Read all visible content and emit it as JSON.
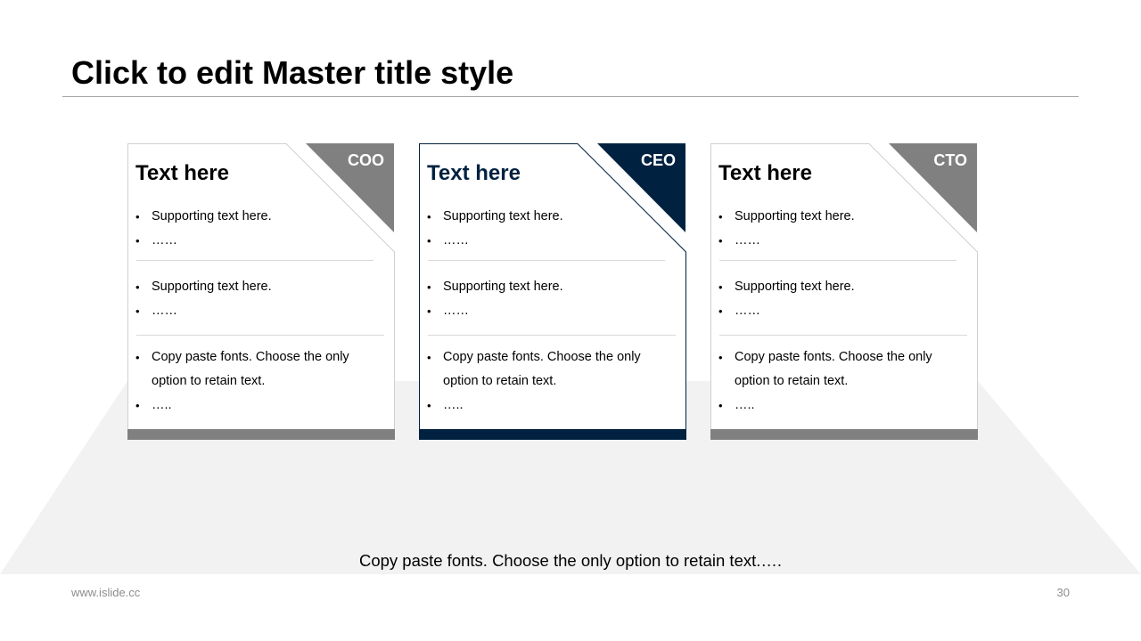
{
  "slide": {
    "title": "Click to edit Master title style",
    "caption": "Copy paste fonts. Choose the only option to retain text.….",
    "footer_url": "www.islide.cc",
    "page_number": "30"
  },
  "colors": {
    "accent_navy": "#002140",
    "gray": "#808080",
    "floor": "#f2f2f2",
    "separator": "#d9d9d9"
  },
  "cards": [
    {
      "role": "COO",
      "heading": "Text here",
      "group1": [
        "Supporting  text here.",
        "……"
      ],
      "group2": [
        "Supporting  text here.",
        "……"
      ],
      "group3": [
        "Copy paste fonts. Choose the only",
        "option to retain text.",
        "….."
      ]
    },
    {
      "role": "CEO",
      "heading": "Text here",
      "group1": [
        "Supporting  text here.",
        "……"
      ],
      "group2": [
        "Supporting  text here.",
        "……"
      ],
      "group3": [
        "Copy paste fonts. Choose the only",
        "option to retain text.",
        "….."
      ]
    },
    {
      "role": "CTO",
      "heading": "Text here",
      "group1": [
        "Supporting  text here.",
        "……"
      ],
      "group2": [
        "Supporting  text here.",
        "……"
      ],
      "group3": [
        "Copy paste fonts. Choose the only",
        "option to retain text.",
        "….."
      ]
    }
  ]
}
